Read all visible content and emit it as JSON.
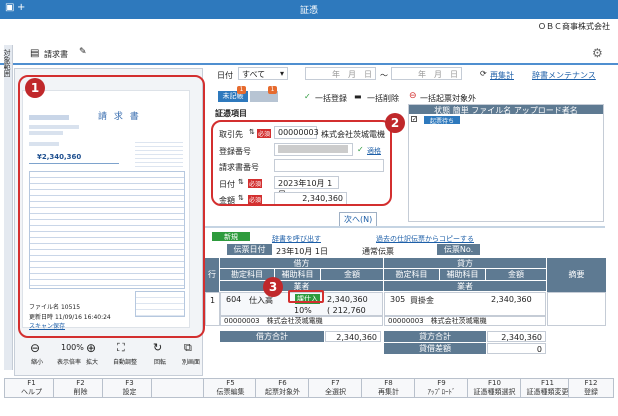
{
  "window": {
    "title": "証憑",
    "company": "ＯＢＣ商事株式会社",
    "plus_icon": "plus-icon"
  },
  "doc": {
    "type": "請求書",
    "side_tab": "対象範囲"
  },
  "filter": {
    "date_label": "日付",
    "date_select": "すべて",
    "from_placeholder": "年　月　日",
    "tilde": "〜",
    "to_placeholder": "年　月　日",
    "refresh": "再集計",
    "maint": "辞書メンテナンス"
  },
  "tabs": {
    "unreg": "未記帳",
    "unreg_badge": "1",
    "reg_badge": "1",
    "bulk_reg": "一括登録",
    "bulk_del": "一括削除",
    "bulk_excl": "一括起票対象外"
  },
  "evidence": {
    "section": "証憑項目",
    "partner_label": "取引先",
    "required": "必須",
    "partner_code": "00000003",
    "partner_name": "株式会社茨城電機",
    "regno_label": "登録番号",
    "regno_status": "適格",
    "invno_label": "請求書番号",
    "date_label": "日付",
    "date_value": "2023年10月 1日",
    "amount_label": "金額",
    "amount_value": "2,340,360",
    "next": "次へ(N)"
  },
  "list": {
    "cols": [
      "状態",
      "簡単",
      "ファイル名",
      "アップロード者名"
    ],
    "row_status": "起票待ち"
  },
  "preview": {
    "title": "請 求 書",
    "amount": "¥2,340,360",
    "file_name_label": "ファイル名",
    "file_name": "10515",
    "updated_label": "更新日時",
    "updated": "11/09/16 16:40:24",
    "zoom": "100%",
    "zoom_label": "表示倍率",
    "shrink": "縮小",
    "enlarge": "拡大",
    "auto": "自動調整",
    "rotate": "回転",
    "other": "別画面",
    "scan": "スキャン保存"
  },
  "journal": {
    "new_tab": "新規",
    "call_link": "辞書を呼び出す",
    "copy_link": "過去の仕訳伝票からコピーする",
    "date_label": "伝票日付",
    "date_value": "23年10月 1日",
    "type": "通常伝票",
    "no_label": "伝票No.",
    "gyo": "行",
    "debit": "借方",
    "credit": "貸方",
    "memo": "摘要",
    "acct": "勘定科目",
    "sub": "補助科目",
    "amount": "金額",
    "partner": "業者",
    "rows": [
      {
        "no": "1",
        "d_code": "604",
        "d_acct": "仕入高",
        "d_tax": "課仕入",
        "d_amount": "2,340,360",
        "d_rate": "10%",
        "d_taxamt": "( 212,760",
        "c_code": "305",
        "c_acct": "買掛金",
        "c_amount": "2,340,360",
        "d_pcode": "00000003",
        "d_pname": "株式会社茨城電機",
        "c_pcode": "00000003",
        "c_pname": "株式会社茨城電機"
      }
    ],
    "debit_total_label": "借方合計",
    "debit_total": "2,340,360",
    "credit_total_label": "貸方合計",
    "credit_total": "2,340,360",
    "diff_label": "貸借差額",
    "diff": "0"
  },
  "fkeys": [
    {
      "k": "F1",
      "l": "ヘルプ"
    },
    {
      "k": "F2",
      "l": "削除"
    },
    {
      "k": "F3",
      "l": "設定"
    },
    {
      "k": "",
      "l": ""
    },
    {
      "k": "F5",
      "l": "伝票編集"
    },
    {
      "k": "F6",
      "l": "起票対象外"
    },
    {
      "k": "F7",
      "l": "全選択"
    },
    {
      "k": "F8",
      "l": "再集計"
    },
    {
      "k": "F9",
      "l": "ｱｯﾌﾟﾛｰﾄﾞ"
    },
    {
      "k": "F10",
      "l": "証憑種類選択"
    },
    {
      "k": "F11",
      "l": "証憑種類変更"
    },
    {
      "k": "F12",
      "l": "登録"
    }
  ],
  "callouts": [
    "1",
    "2",
    "3"
  ]
}
